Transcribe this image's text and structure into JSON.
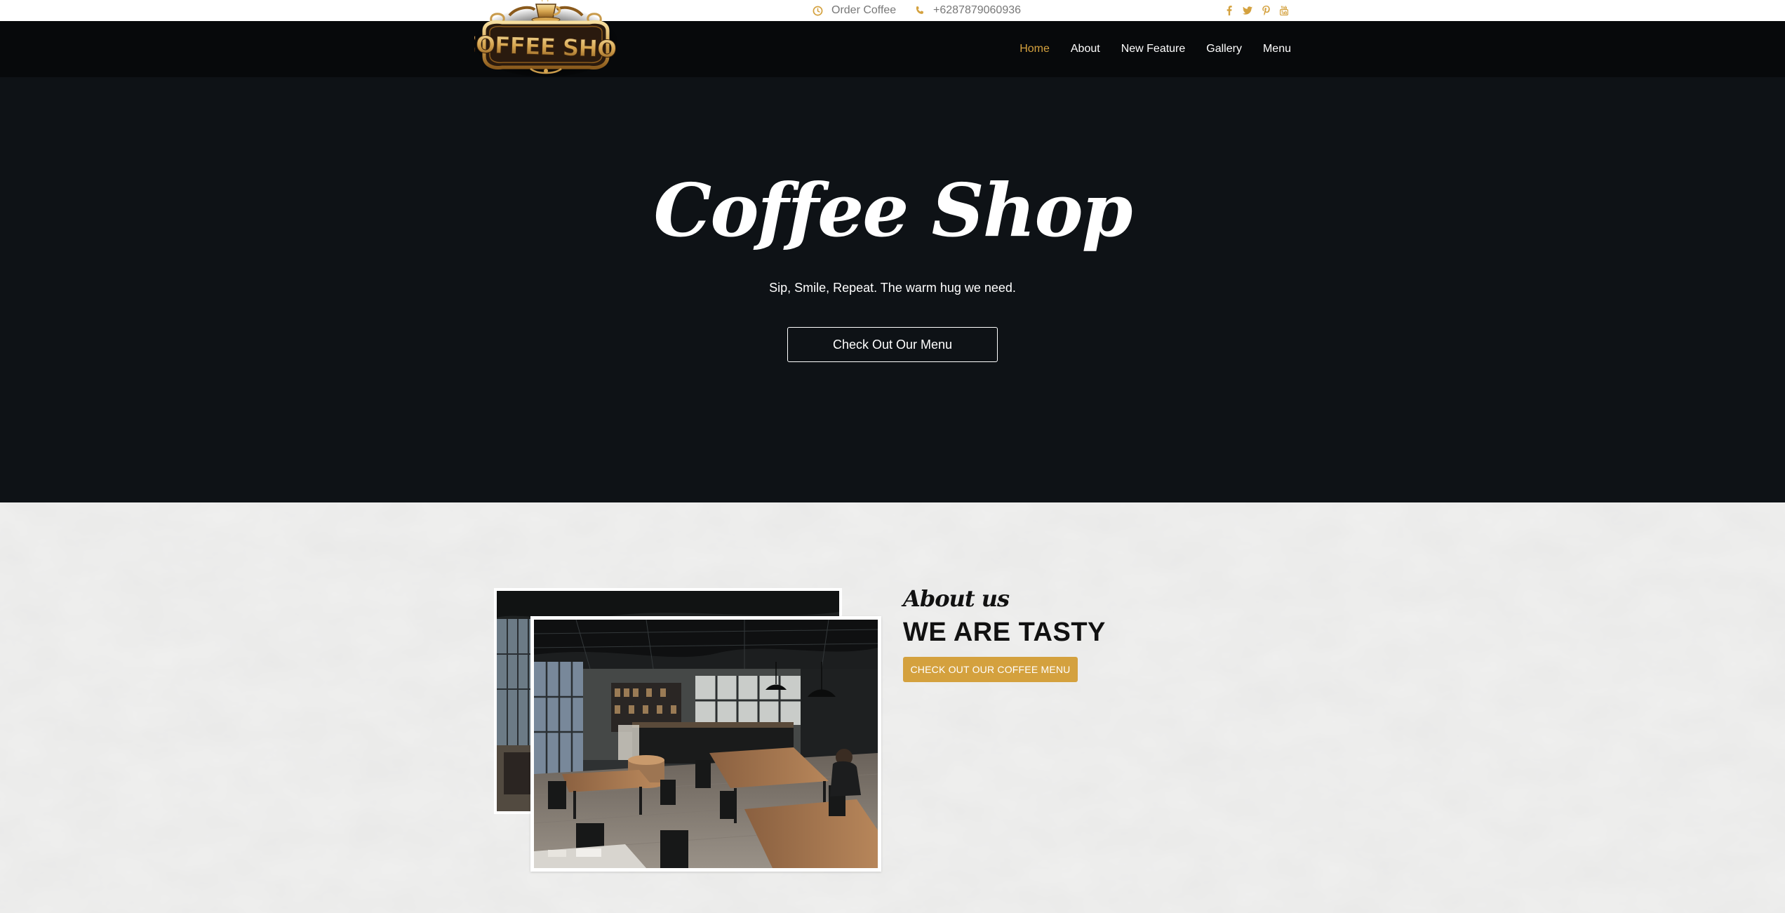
{
  "topbar": {
    "order_icon": "clock-icon",
    "order_text": "Order Coffee",
    "phone_icon": "phone-icon",
    "phone_text": "+6287879060936",
    "socials": [
      "facebook-icon",
      "twitter-icon",
      "pinterest-icon",
      "youtube-icon"
    ]
  },
  "logo": {
    "text": "COFFEE SHOP"
  },
  "nav": {
    "items": [
      "Home",
      "About",
      "New Feature",
      "Gallery",
      "Menu"
    ],
    "active": "Home"
  },
  "hero": {
    "title": "Coffee Shop",
    "subtitle": "Sip, Smile, Repeat. The warm hug we need.",
    "button": "Check Out Our Menu"
  },
  "about": {
    "eyebrow": "About us",
    "heading": "WE ARE TASTY",
    "button": "CHECK OUT OUR COFFEE MENU"
  },
  "colors": {
    "accent": "#d4a13e",
    "navbar": "#07090b",
    "hero": "#0e1216",
    "section_bg": "#f0f0ef"
  }
}
